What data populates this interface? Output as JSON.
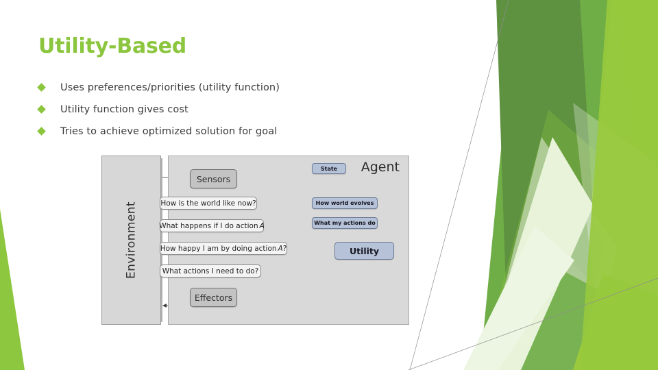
{
  "slide": {
    "title": "Utility-Based",
    "title_color": "#8CC63E",
    "background_color": "#FFFFFF"
  },
  "bullets": {
    "marker": "diamond-bullet",
    "marker_color": "#8CC63E",
    "items": [
      {
        "label": "Uses preferences/priorities (utility function)"
      },
      {
        "label": "Utility function gives cost"
      },
      {
        "label": "Tries to achieve optimized solution for goal"
      }
    ]
  },
  "diagram": {
    "environment_label": "Environment",
    "agent_label": "Agent",
    "colors": {
      "environment_fill": "#D7D7D7",
      "agent_fill": "#D9D9D9",
      "strong_node_fill": "#C3C3C3",
      "question_node_fill": "#F4F4F4",
      "blue_node_fill": "#B6C2D8"
    },
    "nodes": {
      "sensors": "Sensors",
      "effectors": "Effectors",
      "world_now": "How is the world like now?",
      "what_happens_prefix": "What happens if I do action",
      "what_happens_var": "A",
      "how_happy_prefix": "How happy I am by doing action",
      "how_happy_var": "A",
      "how_happy_suffix": "?",
      "what_actions": "What actions I need to do?",
      "state": "State",
      "how_world_evolves": "How world evolves",
      "what_my_actions_do": "What my actions do",
      "utility": "Utility"
    }
  },
  "decoration": {
    "palette": {
      "bright_green": "#8DC63F",
      "mid_green": "#6FAE46",
      "dark_green": "#5E9140",
      "deep_green": "#4E8A33",
      "pale_green": "#D4E8BC",
      "very_pale_green": "#E6F2D8",
      "left_wedge_green": "#8DC63F",
      "hairline_gray": "#9A9A9A"
    }
  }
}
